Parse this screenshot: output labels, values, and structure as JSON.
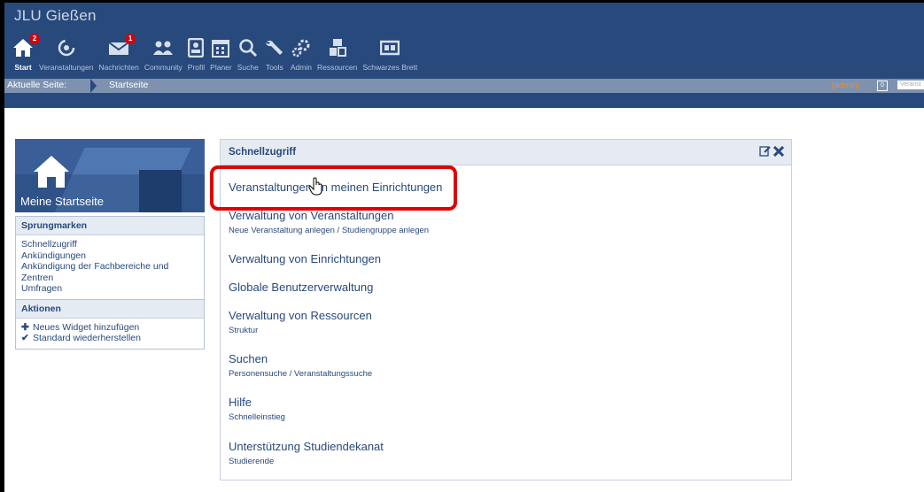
{
  "app": {
    "title": "JLU Gießen"
  },
  "nav": [
    {
      "label": "Start",
      "icon": "home-icon",
      "badge": "2",
      "active": true
    },
    {
      "label": "Veranstaltungen",
      "icon": "seminar-icon",
      "badge": null
    },
    {
      "label": "Nachrichten",
      "icon": "mail-icon",
      "badge": "1"
    },
    {
      "label": "Community",
      "icon": "community-icon",
      "badge": null
    },
    {
      "label": "Profil",
      "icon": "profile-icon",
      "badge": null
    },
    {
      "label": "Planer",
      "icon": "calendar-icon",
      "badge": null
    },
    {
      "label": "Suche",
      "icon": "search-icon",
      "badge": null
    },
    {
      "label": "Tools",
      "icon": "wrench-icon",
      "badge": null
    },
    {
      "label": "Admin",
      "icon": "admin-gear-icon",
      "badge": null
    },
    {
      "label": "Ressourcen",
      "icon": "resources-icon",
      "badge": null
    },
    {
      "label": "Schwarzes Brett",
      "icon": "board-icon",
      "badge": null
    }
  ],
  "breadcrumb": {
    "label": "Aktuelle Seite:",
    "current": "Startseite"
  },
  "userbar": {
    "role": "[admin]",
    "count": "0",
    "search_placeholder": "Veranst"
  },
  "sidebar": {
    "banner_title": "Meine Startseite",
    "jump_head": "Sprungmarken",
    "jump_items": [
      "Schnellzugriff",
      "Ankündigungen",
      "Ankündigung der Fachbereiche und",
      "Zentren",
      "Umfragen"
    ],
    "actions_head": "Aktionen",
    "actions": [
      {
        "label": "Neues Widget hinzufügen",
        "icon": "plus-icon"
      },
      {
        "label": "Standard wiederherstellen",
        "icon": "check-icon"
      }
    ]
  },
  "widget": {
    "title": "Schnellzugriff",
    "items": [
      {
        "label": "Veranstaltungen an meinen Einrichtungen",
        "sub": null
      },
      {
        "label": "Verwaltung von Veranstaltungen",
        "sub": "Neue Veranstaltung anlegen / Studiengruppe anlegen"
      },
      {
        "label": "Verwaltung von Einrichtungen",
        "sub": null
      },
      {
        "label": "Globale Benutzerverwaltung",
        "sub": null
      },
      {
        "label": "Verwaltung von Ressourcen",
        "sub": "Struktur"
      },
      {
        "label": "Suchen",
        "sub": "Personensuche / Veranstaltungssuche"
      },
      {
        "label": "Hilfe",
        "sub": "Schnelleinstieg"
      },
      {
        "label": "Unterstützung Studiendekanat",
        "sub": "Studierende"
      }
    ]
  },
  "colors": {
    "header": "#28497c",
    "breadcrumb": "#7e92b0",
    "highlight": "#e00000",
    "admin": "#f08a24",
    "badge": "#d6000b"
  }
}
